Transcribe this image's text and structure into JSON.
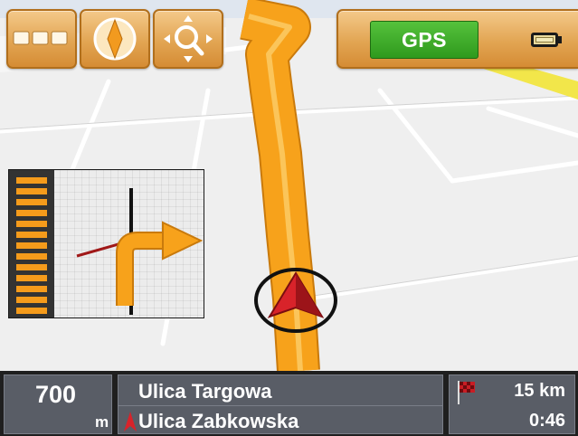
{
  "toolbar": {
    "menu_icon": "menu-dots-icon",
    "compass_icon": "compass-icon",
    "zoom_icon": "zoom-pan-icon",
    "gps_label": "GPS",
    "battery_icon": "battery-icon"
  },
  "maneuver": {
    "icon": "turn-right-arrow-icon"
  },
  "status": {
    "distance_value": "700",
    "distance_unit": "m",
    "current_street": "Ulica Targowa",
    "next_street": "Ulica Zabkowska",
    "remaining_distance": "15 km",
    "remaining_time": "0:46"
  },
  "colors": {
    "route": "#f7a21b",
    "toolbar": "#e2a553",
    "gps_active": "#3aa725",
    "status_panel": "#595d66"
  }
}
